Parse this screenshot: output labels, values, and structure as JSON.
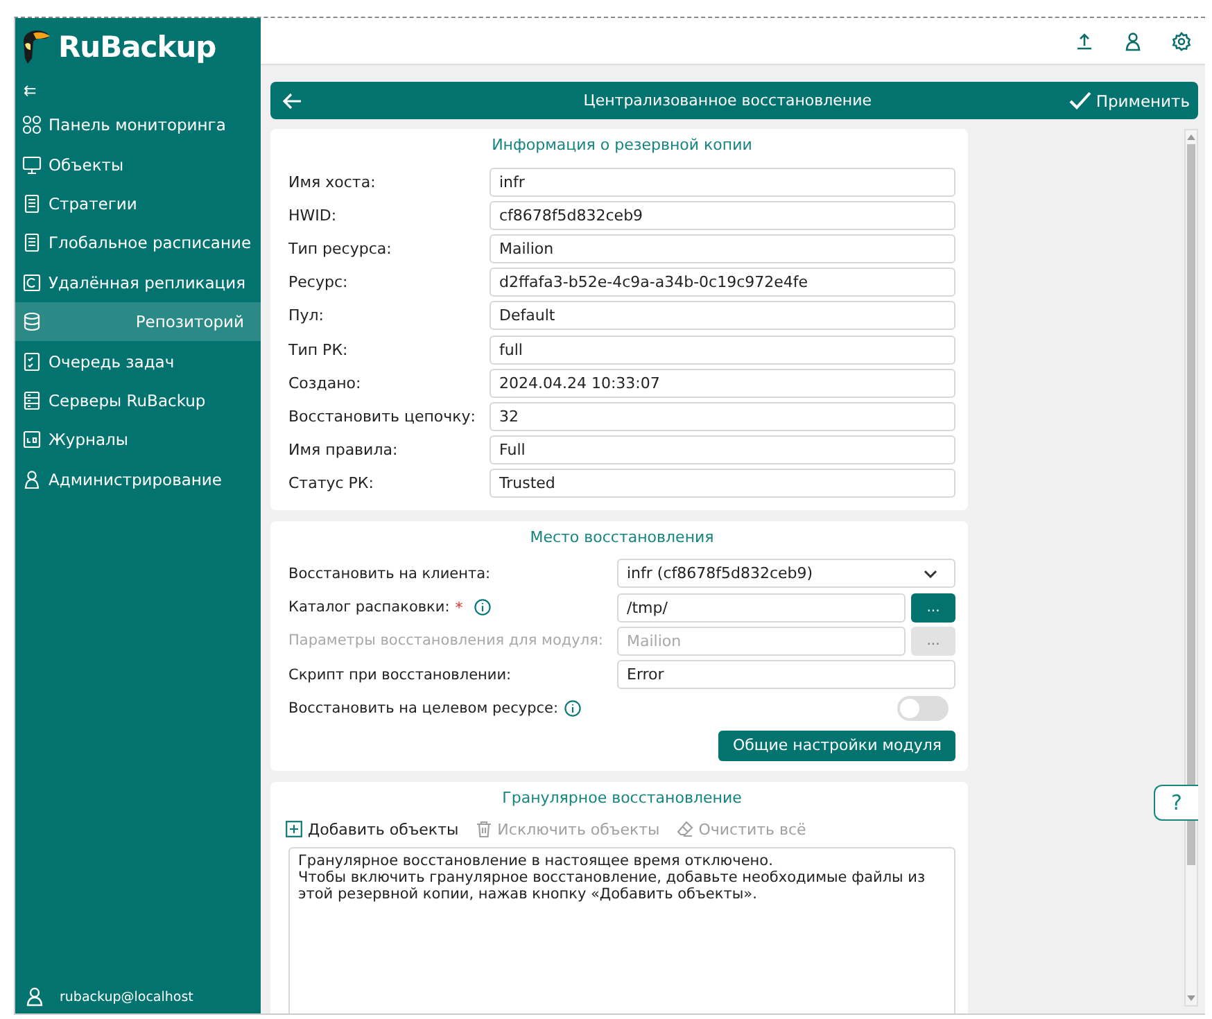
{
  "sidebar": {
    "logo_text": "RuBackup",
    "collapse_icon": "⇇",
    "items": [
      {
        "label": "Панель мониторинга",
        "selected": false
      },
      {
        "label": "Объекты",
        "selected": false
      },
      {
        "label": "Стратегии",
        "selected": false
      },
      {
        "label": "Глобальное расписание",
        "selected": false
      },
      {
        "label": "Удалённая репликация",
        "selected": false
      },
      {
        "label": "Репозиторий",
        "selected": true
      },
      {
        "label": "Очередь задач",
        "selected": false
      },
      {
        "label": "Серверы RuBackup",
        "selected": false
      },
      {
        "label": "Журналы",
        "selected": false
      },
      {
        "label": "Администрирование",
        "selected": false
      }
    ],
    "user": "rubackup@localhost"
  },
  "header": {
    "title": "Централизованное восстановление",
    "apply": "Применить"
  },
  "backup_info": {
    "title": "Информация о резервной копии",
    "fields": [
      {
        "label": "Имя хоста:",
        "value": "infr"
      },
      {
        "label": "HWID:",
        "value": "cf8678f5d832ceb9"
      },
      {
        "label": "Тип ресурса:",
        "value": "Mailion"
      },
      {
        "label": "Ресурс:",
        "value": "d2ffafa3-b52e-4c9a-a34b-0c19c972e4fe"
      },
      {
        "label": "Пул:",
        "value": "Default"
      },
      {
        "label": "Тип РК:",
        "value": "full"
      },
      {
        "label": "Создано:",
        "value": "2024.04.24 10:33:07"
      },
      {
        "label": "Восстановить цепочку:",
        "value": "32"
      },
      {
        "label": "Имя правила:",
        "value": "Full"
      },
      {
        "label": "Статус РК:",
        "value": "Trusted"
      }
    ]
  },
  "restore_location": {
    "title": "Место восстановления",
    "rows": [
      {
        "kind": "select",
        "label": "Восстановить на клиента:",
        "value": "infr (cf8678f5d832ceb9)",
        "disabled": false
      },
      {
        "kind": "browse",
        "label": "Каталог распаковки:",
        "value": "/tmp/",
        "button": "...",
        "disabled": false,
        "required": true,
        "info": true
      },
      {
        "kind": "browse",
        "label": "Параметры восстановления для модуля:",
        "placeholder": "Mailion",
        "button": "...",
        "disabled": true
      },
      {
        "kind": "input",
        "label": "Скрипт при восстановлении:",
        "value": "Error",
        "disabled": false
      },
      {
        "kind": "toggle",
        "label": "Восстановить на целевом ресурсе:",
        "on": false,
        "disabled": false,
        "info": true
      }
    ],
    "required_mark": "*",
    "module_settings": "Общие настройки модуля"
  },
  "granular": {
    "title": "Гранулярное восстановление",
    "actions": [
      {
        "label": "Добавить объекты",
        "disabled": false
      },
      {
        "label": "Исключить объекты",
        "disabled": true
      },
      {
        "label": "Очистить всё",
        "disabled": true
      }
    ],
    "message": [
      "Гранулярное восстановление в настоящее время отключено.",
      "Чтобы включить гранулярное восстановление, добавьте необходимые файлы из этой резервной копии, нажав кнопку «Добавить объекты»."
    ]
  },
  "help": "?"
}
